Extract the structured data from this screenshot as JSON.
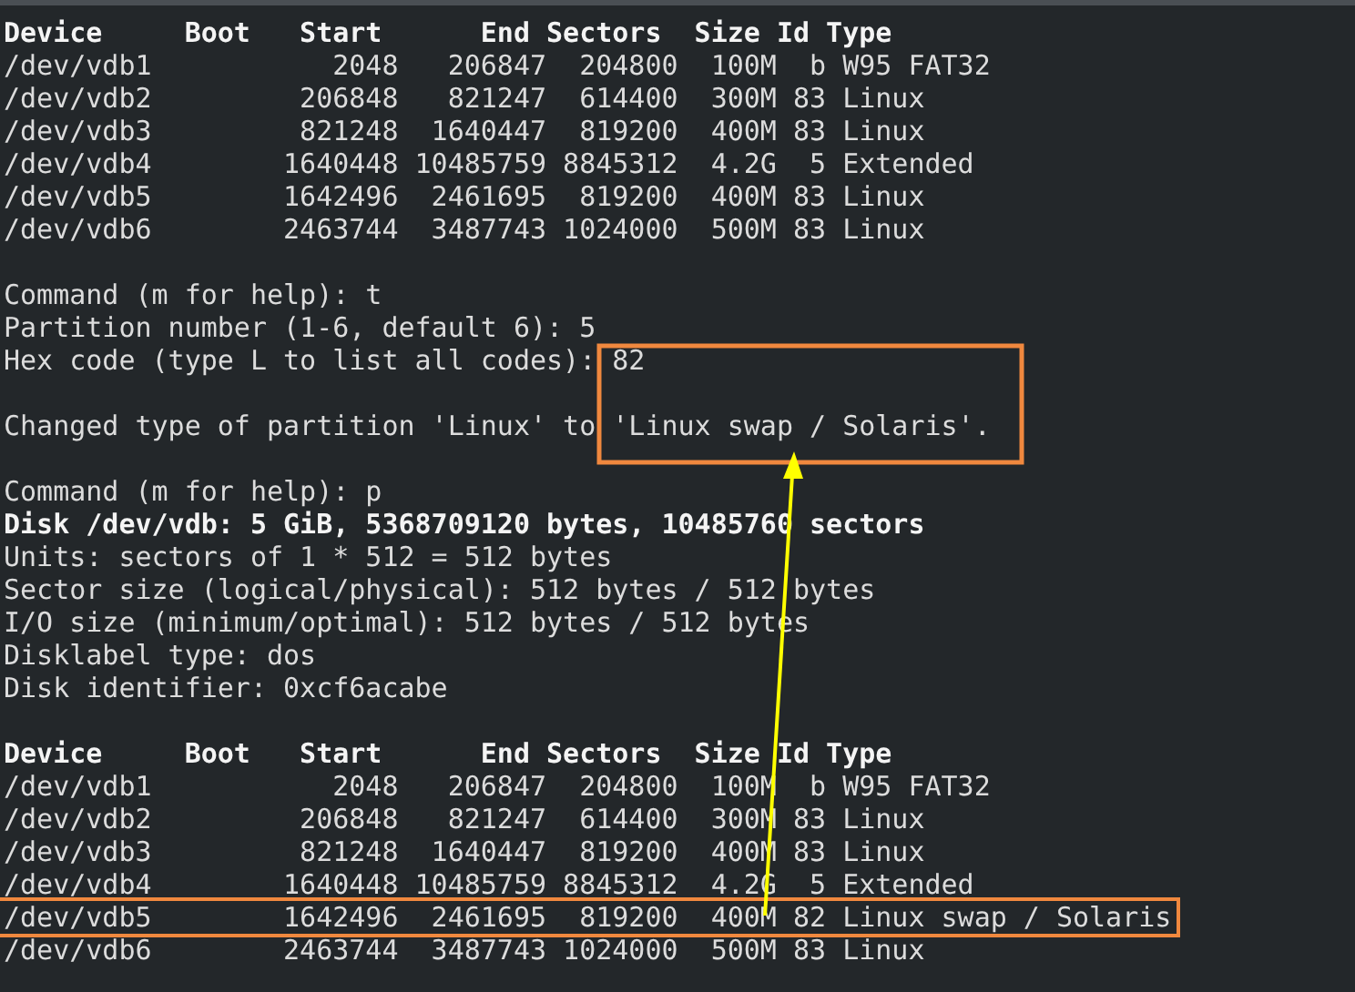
{
  "terminal": {
    "lines": [
      {
        "kind": "text",
        "text": "Device     Boot   Start      End Sectors  Size Id Type",
        "bold": true,
        "highlighted": false
      },
      {
        "kind": "text",
        "text": "/dev/vdb1           2048   206847  204800  100M  b W95 FAT32",
        "bold": false,
        "highlighted": false
      },
      {
        "kind": "text",
        "text": "/dev/vdb2         206848   821247  614400  300M 83 Linux",
        "bold": false,
        "highlighted": false
      },
      {
        "kind": "text",
        "text": "/dev/vdb3         821248  1640447  819200  400M 83 Linux",
        "bold": false,
        "highlighted": false
      },
      {
        "kind": "text",
        "text": "/dev/vdb4        1640448 10485759 8845312  4.2G  5 Extended",
        "bold": false,
        "highlighted": false
      },
      {
        "kind": "text",
        "text": "/dev/vdb5        1642496  2461695  819200  400M 83 Linux",
        "bold": false,
        "highlighted": false
      },
      {
        "kind": "text",
        "text": "/dev/vdb6        2463744  3487743 1024000  500M 83 Linux",
        "bold": false,
        "highlighted": false
      },
      {
        "kind": "blank"
      },
      {
        "kind": "text",
        "text": "Command (m for help): t",
        "bold": false,
        "highlighted": false
      },
      {
        "kind": "text",
        "text": "Partition number (1-6, default 6): 5",
        "bold": false,
        "highlighted": false
      },
      {
        "kind": "text",
        "text": "Hex code (type L to list all codes): 82",
        "bold": false,
        "highlighted": false
      },
      {
        "kind": "blank"
      },
      {
        "kind": "text",
        "text": "Changed type of partition 'Linux' to 'Linux swap / Solaris'.",
        "bold": false,
        "highlighted": false
      },
      {
        "kind": "blank"
      },
      {
        "kind": "text",
        "text": "Command (m for help): p",
        "bold": false,
        "highlighted": false
      },
      {
        "kind": "text",
        "text": "Disk /dev/vdb: 5 GiB, 5368709120 bytes, 10485760 sectors",
        "bold": true,
        "highlighted": false
      },
      {
        "kind": "text",
        "text": "Units: sectors of 1 * 512 = 512 bytes",
        "bold": false,
        "highlighted": false
      },
      {
        "kind": "text",
        "text": "Sector size (logical/physical): 512 bytes / 512 bytes",
        "bold": false,
        "highlighted": false
      },
      {
        "kind": "text",
        "text": "I/O size (minimum/optimal): 512 bytes / 512 bytes",
        "bold": false,
        "highlighted": false
      },
      {
        "kind": "text",
        "text": "Disklabel type: dos",
        "bold": false,
        "highlighted": false
      },
      {
        "kind": "text",
        "text": "Disk identifier: 0xcf6acabe",
        "bold": false,
        "highlighted": false
      },
      {
        "kind": "blank"
      },
      {
        "kind": "text",
        "text": "Device     Boot   Start      End Sectors  Size Id Type",
        "bold": true,
        "highlighted": false
      },
      {
        "kind": "text",
        "text": "/dev/vdb1           2048   206847  204800  100M  b W95 FAT32",
        "bold": false,
        "highlighted": false
      },
      {
        "kind": "text",
        "text": "/dev/vdb2         206848   821247  614400  300M 83 Linux",
        "bold": false,
        "highlighted": false
      },
      {
        "kind": "text",
        "text": "/dev/vdb3         821248  1640447  819200  400M 83 Linux",
        "bold": false,
        "highlighted": false
      },
      {
        "kind": "text",
        "text": "/dev/vdb4        1640448 10485759 8845312  4.2G  5 Extended",
        "bold": false,
        "highlighted": false
      },
      {
        "kind": "text",
        "text": "/dev/vdb5        1642496  2461695  819200  400M 82 Linux swap / Solaris",
        "bold": false,
        "highlighted": true
      },
      {
        "kind": "text",
        "text": "/dev/vdb6        2463744  3487743 1024000  500M 83 Linux",
        "bold": false,
        "highlighted": false
      }
    ]
  }
}
